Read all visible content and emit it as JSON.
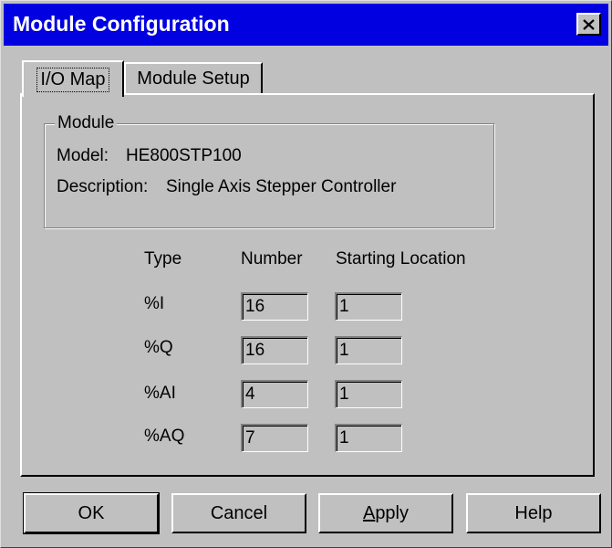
{
  "window": {
    "title": "Module Configuration"
  },
  "tabs": [
    {
      "label": "I/O Map"
    },
    {
      "label": "Module Setup"
    }
  ],
  "module": {
    "group_label": "Module",
    "model_label": "Model:",
    "model_value": "HE800STP100",
    "description_label": "Description:",
    "description_value": "Single Axis Stepper Controller"
  },
  "io_table": {
    "headers": [
      "Type",
      "Number",
      "Starting Location"
    ],
    "rows": [
      {
        "type": "%I",
        "number": "16",
        "start": "1"
      },
      {
        "type": "%Q",
        "number": "16",
        "start": "1"
      },
      {
        "type": "%AI",
        "number": "4",
        "start": "1"
      },
      {
        "type": "%AQ",
        "number": "7",
        "start": "1"
      }
    ]
  },
  "buttons": {
    "ok": "OK",
    "cancel": "Cancel",
    "apply_underline": "A",
    "apply_rest": "pply",
    "help": "Help"
  },
  "colors": {
    "titlebar": "#0000e0",
    "face": "#c0c0c0"
  }
}
